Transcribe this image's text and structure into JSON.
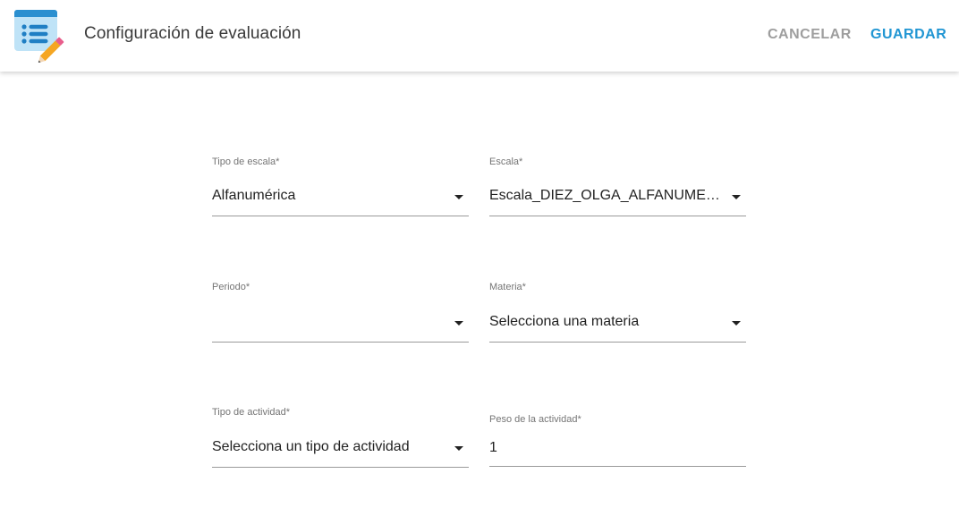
{
  "header": {
    "title": "Configuración de evaluación",
    "logo_icon": "checklist-pencil-icon",
    "cancel_label": "CANCELAR",
    "save_label": "GUARDAR"
  },
  "colors": {
    "primary": "#2196d3",
    "muted_button": "#9e9e9e"
  },
  "form": {
    "tipo_escala": {
      "label": "Tipo de escala*",
      "value": "Alfanumérica"
    },
    "escala": {
      "label": "Escala*",
      "value": "Escala_DIEZ_OLGA_ALFANUMERICA"
    },
    "periodo": {
      "label": "Periodo*",
      "value": ""
    },
    "materia": {
      "label": "Materia*",
      "value": "Selecciona una materia"
    },
    "tipo_actividad": {
      "label": "Tipo de actividad*",
      "value": "Selecciona un tipo de actividad"
    },
    "peso_actividad": {
      "label": "Peso de la actividad*",
      "value": "1"
    }
  }
}
